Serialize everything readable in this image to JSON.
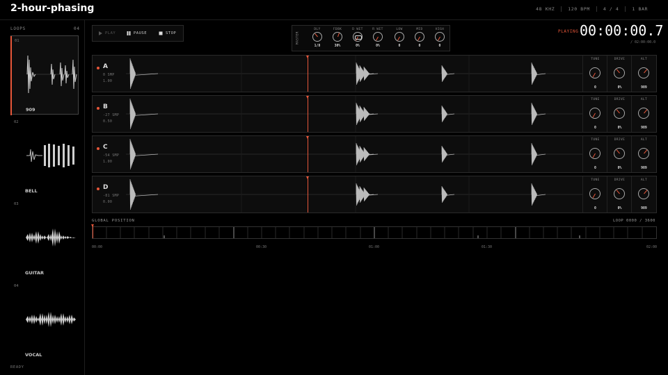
{
  "app": {
    "title": "2-hour-phasing"
  },
  "header": {
    "stats": [
      "48 KHZ",
      "120 BPM",
      "4 / 4",
      "1 BAR"
    ]
  },
  "sidebar": {
    "caption": "LOOPS",
    "count": "04",
    "loops": [
      {
        "num": "01",
        "name": "909",
        "active": true
      },
      {
        "num": "02",
        "name": "BELL",
        "active": false
      },
      {
        "num": "03",
        "name": "GUITAR",
        "active": false
      },
      {
        "num": "04",
        "name": "VOCAL",
        "active": false
      }
    ],
    "status": "READY"
  },
  "transport": {
    "play": "PLAY",
    "pause": "PAUSE",
    "stop": "STOP",
    "playing_state": "PLAYING"
  },
  "macro": {
    "title": "MASTER",
    "knobs": [
      {
        "label": "DLY",
        "value": "1/8"
      },
      {
        "label": "FDBK",
        "value": "30%"
      },
      {
        "label": "D WET",
        "value": "0%"
      },
      {
        "label": "R WET",
        "value": "0%"
      },
      {
        "label": "LOW",
        "value": "0"
      },
      {
        "label": "MID",
        "value": "0"
      },
      {
        "label": "HIGH",
        "value": "0"
      }
    ]
  },
  "time": {
    "current": "00:00:00.7",
    "total": "/ 02:00:00.0"
  },
  "tracks": [
    {
      "letter": "A",
      "line1": "0 SMP",
      "line2": "1.00",
      "tune": "0",
      "drive": "0%",
      "alt": "909"
    },
    {
      "letter": "B",
      "line1": "-27 SMP",
      "line2": "0.50",
      "tune": "0",
      "drive": "0%",
      "alt": "909"
    },
    {
      "letter": "C",
      "line1": "-54 SMP",
      "line2": "1.00",
      "tune": "0",
      "drive": "0%",
      "alt": "909"
    },
    {
      "letter": "D",
      "line1": "-81 SMP",
      "line2": "0.00",
      "tune": "0",
      "drive": "0%",
      "alt": "909"
    }
  ],
  "track_controls": {
    "tune": "TUNE",
    "drive": "DRIVE",
    "alt": "ALT"
  },
  "global": {
    "caption": "GLOBAL POSITION",
    "loop_counter": "LOOP 0000 / 3600",
    "ticks": [
      "00:00",
      "00:30",
      "01:00",
      "01:30",
      "02:00"
    ],
    "progress": 0.0
  },
  "colors": {
    "accent": "#e8573a",
    "background": "#000000",
    "panel": "#0d0d0d"
  }
}
